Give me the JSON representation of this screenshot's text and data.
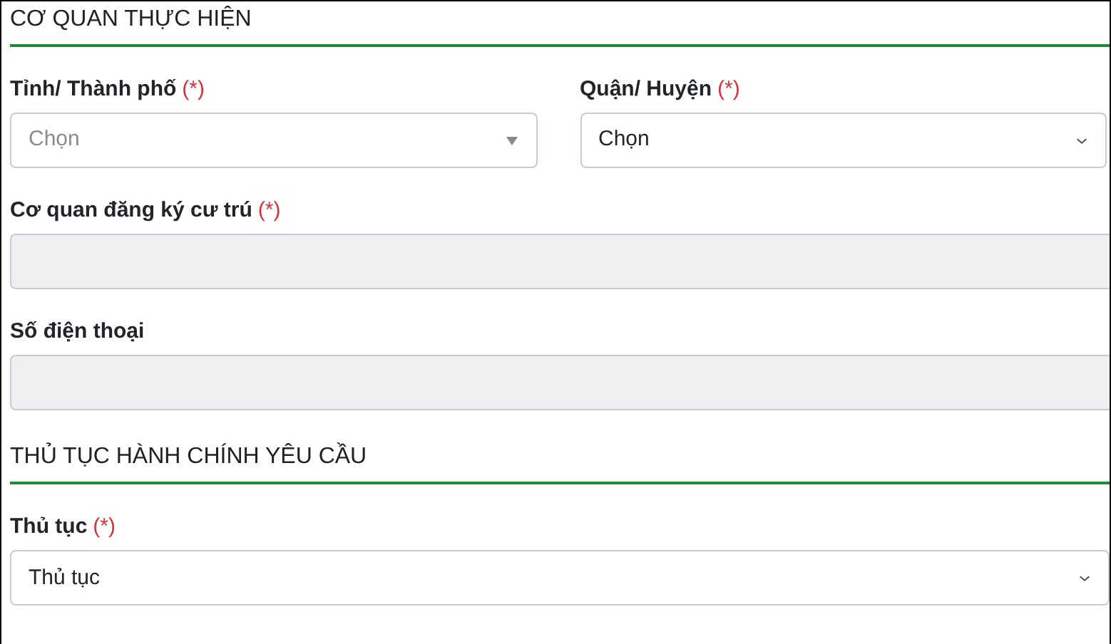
{
  "sections": [
    {
      "title": "CƠ QUAN THỰC HIỆN",
      "rows": [
        [
          {
            "label": "Tỉnh/ Thành phố",
            "required_mark": "(*)",
            "kind": "combo",
            "placeholder": "Chọn"
          },
          {
            "label": "Quận/ Huyện",
            "required_mark": "(*)",
            "kind": "select",
            "value": "Chọn"
          }
        ],
        [
          {
            "label": "Cơ quan đăng ký cư trú",
            "required_mark": "(*)",
            "kind": "readonly"
          }
        ],
        [
          {
            "label": "Số điện thoại",
            "kind": "readonly"
          }
        ]
      ]
    },
    {
      "title": "THỦ TỤC HÀNH CHÍNH YÊU CẦU",
      "rows": [
        [
          {
            "label": "Thủ tục",
            "required_mark": "(*)",
            "kind": "select",
            "value": "Thủ tục"
          }
        ]
      ]
    }
  ]
}
